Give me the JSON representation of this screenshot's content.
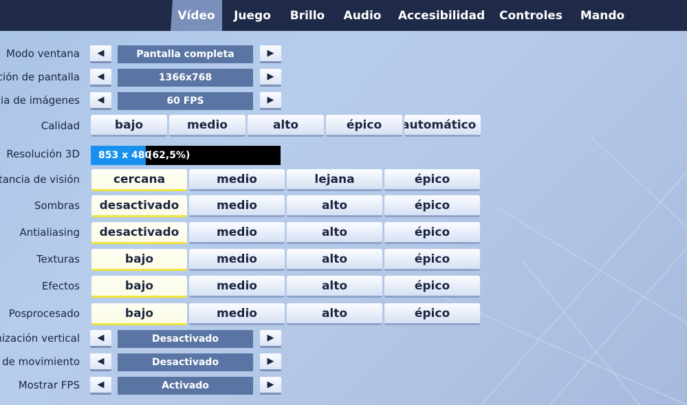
{
  "tabs": [
    {
      "label": "Vídeo",
      "active": true
    },
    {
      "label": "Juego"
    },
    {
      "label": "Brillo"
    },
    {
      "label": "Audio"
    },
    {
      "label": "Accesibilidad"
    },
    {
      "label": "Controles"
    },
    {
      "label": "Mando"
    }
  ],
  "arrows": {
    "left": "◀",
    "right": "▶"
  },
  "settings": {
    "window_mode": {
      "label": "Modo ventana",
      "value": "Pantalla completa"
    },
    "resolution": {
      "label": "ución de pantalla",
      "value": "1366x768"
    },
    "frame_rate": {
      "label": "cia de imágenes",
      "value": "60 FPS"
    },
    "quality": {
      "label": "Calidad",
      "options": [
        "bajo",
        "medio",
        "alto",
        "épico",
        "automático"
      ]
    },
    "res3d": {
      "label": "Resolución 3D",
      "value": "853 x 480",
      "percent_text": "(62,5%)",
      "fill_fraction": 0.29
    },
    "view_distance": {
      "label": "stancia de visión",
      "options": [
        "cercana",
        "medio",
        "lejana",
        "épico"
      ],
      "selected": 0
    },
    "shadows": {
      "label": "Sombras",
      "options": [
        "desactivado",
        "medio",
        "alto",
        "épico"
      ],
      "selected": 0
    },
    "antialiasing": {
      "label": "Antialiasing",
      "options": [
        "desactivado",
        "medio",
        "alto",
        "épico"
      ],
      "selected": 0
    },
    "textures": {
      "label": "Texturas",
      "options": [
        "bajo",
        "medio",
        "alto",
        "épico"
      ],
      "selected": 0
    },
    "effects": {
      "label": "Efectos",
      "options": [
        "bajo",
        "medio",
        "alto",
        "épico"
      ],
      "selected": 0
    },
    "postprocessing": {
      "label": "Posprocesado",
      "options": [
        "bajo",
        "medio",
        "alto",
        "épico"
      ],
      "selected": 0
    },
    "vsync": {
      "label": "onización vertical",
      "value": "Desactivado"
    },
    "motion_blur": {
      "label": "e de movimiento",
      "value": "Desactivado"
    },
    "show_fps": {
      "label": "Mostrar FPS",
      "value": "Activado"
    }
  },
  "colors": {
    "topbar": "#1e2a48",
    "active_tab": "#7a8fb9",
    "value_box": "#5a75a4",
    "selected_underline": "#efe53a",
    "res3d_fill": "#1891ee"
  }
}
